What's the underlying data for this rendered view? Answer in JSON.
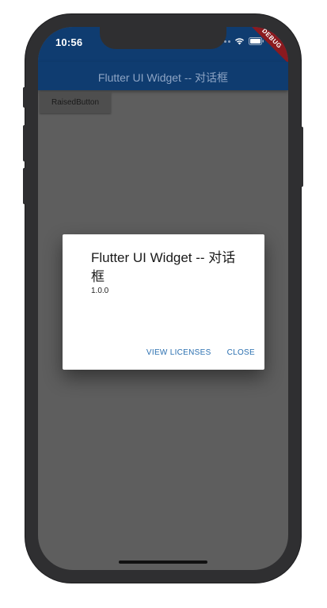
{
  "status_bar": {
    "time": "10:56",
    "debug_banner": "DEBUG"
  },
  "app_bar": {
    "title": "Flutter UI Widget -- 对话框"
  },
  "body": {
    "raised_button_label": "RaisedButton"
  },
  "dialog": {
    "title": "Flutter UI Widget -- 对话框",
    "version": "1.0.0",
    "view_licenses_label": "VIEW LICENSES",
    "close_label": "CLOSE"
  },
  "colors": {
    "app_bar": "#0f3c70",
    "scrim": "#5e5e5e",
    "dialog_action": "#2a6fb0",
    "debug_banner": "#8b1a1f"
  },
  "icons": [
    "signal-dots-icon",
    "wifi-icon",
    "battery-icon"
  ]
}
